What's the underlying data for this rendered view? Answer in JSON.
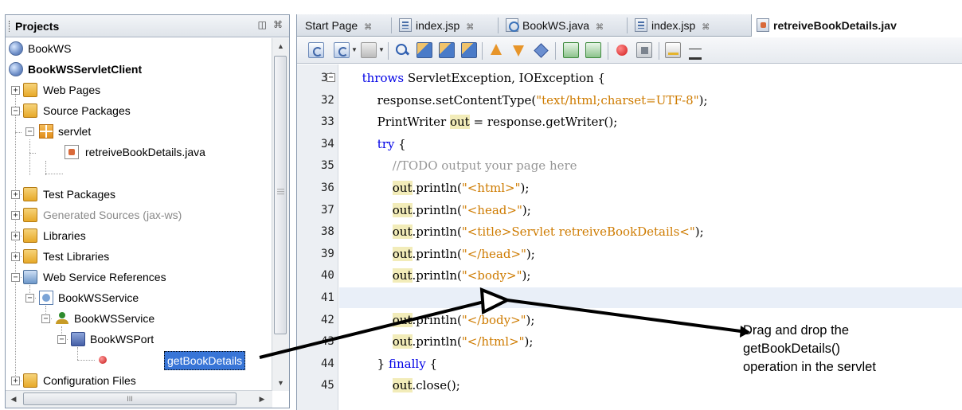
{
  "projects_panel": {
    "title": "Projects",
    "minimize_glyph": "◫",
    "close_glyph": "⌘",
    "tree": [
      {
        "label": "BookWS",
        "icon": "web-project-icon",
        "bold": false
      },
      {
        "label": "BookWSServletClient",
        "icon": "web-project-icon",
        "bold": true
      },
      {
        "label": "Web Pages",
        "icon": "folder-icon"
      },
      {
        "label": "Source Packages",
        "icon": "folder-icon"
      },
      {
        "label": "servlet",
        "icon": "package-icon"
      },
      {
        "label": "retreiveBookDetails.java",
        "icon": "java-file-icon"
      },
      {
        "label": "Test Packages",
        "icon": "folder-icon"
      },
      {
        "label": "Generated Sources (jax-ws)",
        "icon": "folder-icon",
        "dim": true
      },
      {
        "label": "Libraries",
        "icon": "library-icon"
      },
      {
        "label": "Test Libraries",
        "icon": "library-icon"
      },
      {
        "label": "Web Service References",
        "icon": "ws-references-icon"
      },
      {
        "label": "BookWSService",
        "icon": "web-service-icon"
      },
      {
        "label": "BookWSService",
        "icon": "service-icon"
      },
      {
        "label": "BookWSPort",
        "icon": "port-icon"
      },
      {
        "label": "getBookDetails",
        "icon": "operation-icon",
        "selected": true
      },
      {
        "label": "Configuration Files",
        "icon": "folder-icon"
      }
    ],
    "hscroll_grip": "III"
  },
  "editor": {
    "tabs": [
      {
        "label": "Start Page",
        "icon": "",
        "active": false
      },
      {
        "label": "index.jsp",
        "icon": "jsp-file-icon",
        "active": false
      },
      {
        "label": "BookWS.java",
        "icon": "java-class-icon",
        "active": false
      },
      {
        "label": "index.jsp",
        "icon": "jsp-file-icon",
        "active": false
      },
      {
        "label": "retreiveBookDetails.jav",
        "icon": "java-file-icon",
        "active": true
      }
    ],
    "tab_close_glyph": "⌘",
    "code_lines": [
      {
        "num": "31",
        "fold": "−",
        "text": "throws ServletException, IOException {"
      },
      {
        "num": "32",
        "text": "response.setContentType(\"text/html;charset=UTF-8\");"
      },
      {
        "num": "33",
        "text": "PrintWriter out = response.getWriter();"
      },
      {
        "num": "34",
        "text": "try {"
      },
      {
        "num": "35",
        "text": "//TODO output your page here"
      },
      {
        "num": "36",
        "text": "out.println(\"<html>\");"
      },
      {
        "num": "37",
        "text": "out.println(\"<head>\");"
      },
      {
        "num": "38",
        "text": "out.println(\"<title>Servlet retreiveBookDetails<\");"
      },
      {
        "num": "39",
        "text": "out.println(\"</head>\");"
      },
      {
        "num": "40",
        "text": "out.println(\"<body>\");"
      },
      {
        "num": "41",
        "text": ""
      },
      {
        "num": "42",
        "text": "out.println(\"</body>\");"
      },
      {
        "num": "43",
        "text": "out.println(\"</html>\");"
      },
      {
        "num": "44",
        "text": "} finally {"
      },
      {
        "num": "45",
        "text": "out.close();"
      }
    ]
  },
  "annotation": {
    "line1": "Drag and drop the",
    "line2": "getBookDetails()",
    "line3": "operation in the servlet"
  },
  "colors": {
    "keyword": "#0000e6",
    "string": "#ce7b00",
    "comment": "#969696",
    "selection": "#3875d7",
    "current_line": "#e9eff8",
    "occurrence_highlight": "#f2ecb9"
  }
}
